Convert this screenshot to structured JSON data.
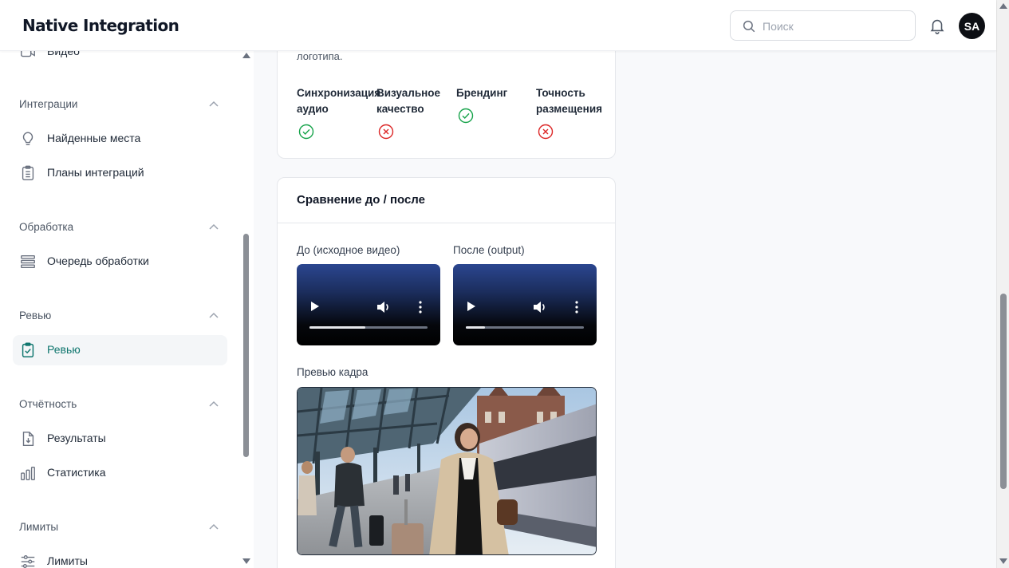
{
  "header": {
    "app_title": "Native Integration",
    "search_placeholder": "Поиск",
    "avatar_initials": "SA"
  },
  "sidebar": {
    "top_partial_item": "Видео",
    "sections": [
      {
        "title": "Интеграции",
        "items": [
          {
            "label": "Найденные места",
            "icon": "lightbulb-icon"
          },
          {
            "label": "Планы интеграций",
            "icon": "clipboard-list-icon"
          }
        ]
      },
      {
        "title": "Обработка",
        "items": [
          {
            "label": "Очередь обработки",
            "icon": "queue-list-icon"
          }
        ]
      },
      {
        "title": "Ревью",
        "items": [
          {
            "label": "Ревью",
            "icon": "clipboard-check-icon",
            "active": true
          }
        ]
      },
      {
        "title": "Отчётность",
        "items": [
          {
            "label": "Результаты",
            "icon": "file-download-icon"
          },
          {
            "label": "Статистика",
            "icon": "bar-chart-icon"
          }
        ]
      },
      {
        "title": "Лимиты",
        "items": [
          {
            "label": "Лимиты",
            "icon": "sliders-icon"
          }
        ]
      }
    ]
  },
  "checks_card": {
    "partial_text": "логотипа.",
    "metrics": [
      {
        "label": "Синхронизация\nаудио",
        "status": "pass",
        "icon": "check-circle-icon"
      },
      {
        "label": "Визуальное\nкачество",
        "status": "fail",
        "icon": "x-circle-icon"
      },
      {
        "label": "Брендинг",
        "status": "pass",
        "icon": "check-circle-icon"
      },
      {
        "label": "Точность\nразмещения",
        "status": "fail",
        "icon": "x-circle-icon"
      }
    ]
  },
  "compare_card": {
    "title": "Сравнение до / после",
    "before_label": "До (исходное видео)",
    "after_label": "После (output)",
    "before_progress": 0.47,
    "after_progress": 0.16,
    "preview_label": "Превью кадра"
  },
  "colors": {
    "pass": "#16a34a",
    "fail": "#dc2626",
    "accent": "#0f766e"
  }
}
